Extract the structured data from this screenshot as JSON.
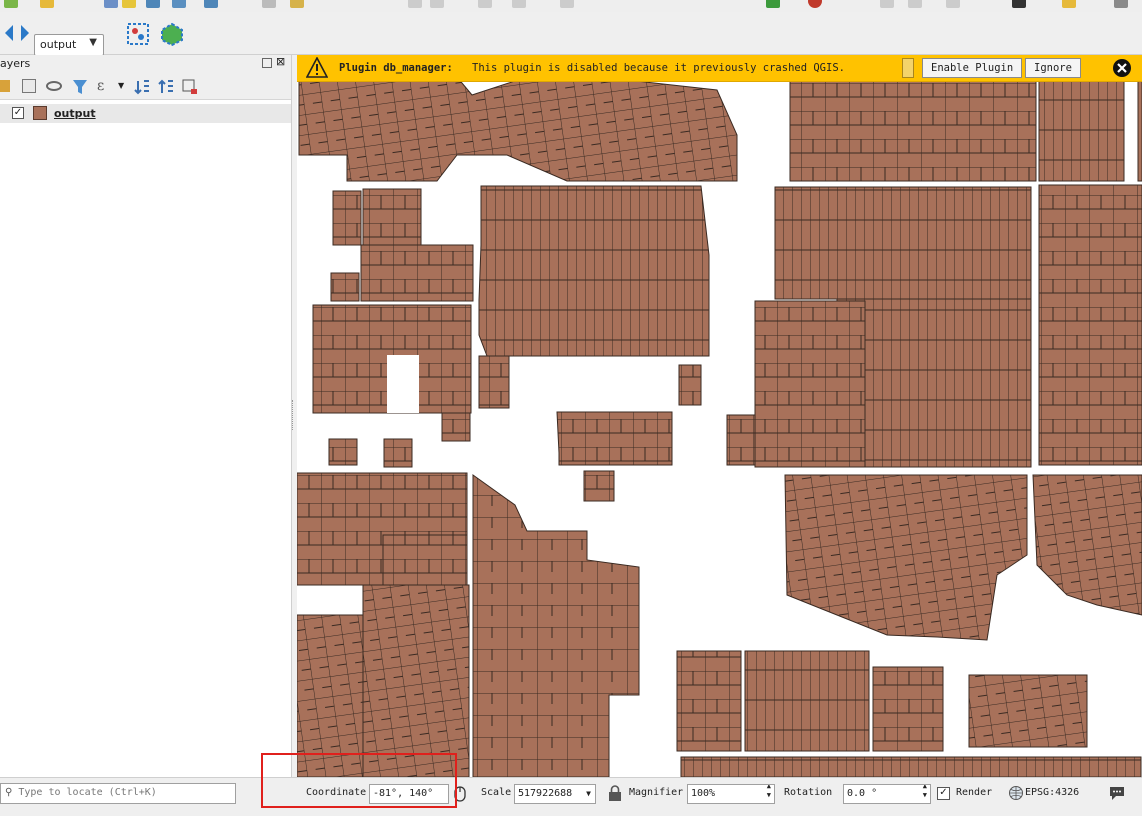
{
  "toolbar": {
    "layer_select_value": "output"
  },
  "layers_panel": {
    "title": "ayers",
    "layer": {
      "name": "output",
      "checked": "✓",
      "color": "#a8715a"
    }
  },
  "plugin_bar": {
    "title": "Plugin db_manager:",
    "message": "This plugin is disabled because it previously crashed QGIS.",
    "enable_label": "Enable Plugin",
    "ignore_label": "Ignore"
  },
  "status_bar": {
    "locate_placeholder": "Type to locate (Ctrl+K)",
    "coordinate_label": "Coordinate",
    "coordinate_value": "-81°, 140°",
    "scale_label": "Scale",
    "scale_value": "517922688",
    "magnifier_label": "Magnifier",
    "magnifier_value": "100%",
    "rotation_label": "Rotation",
    "rotation_value": "0.0 °",
    "render_label": "Render",
    "render_checked": "✓",
    "crs_label": "EPSG:4326"
  },
  "colors": {
    "parcel_fill": "#a8715a",
    "parcel_stroke": "#3a2a22",
    "banner": "#ffc200",
    "highlight": "#e0201c"
  }
}
